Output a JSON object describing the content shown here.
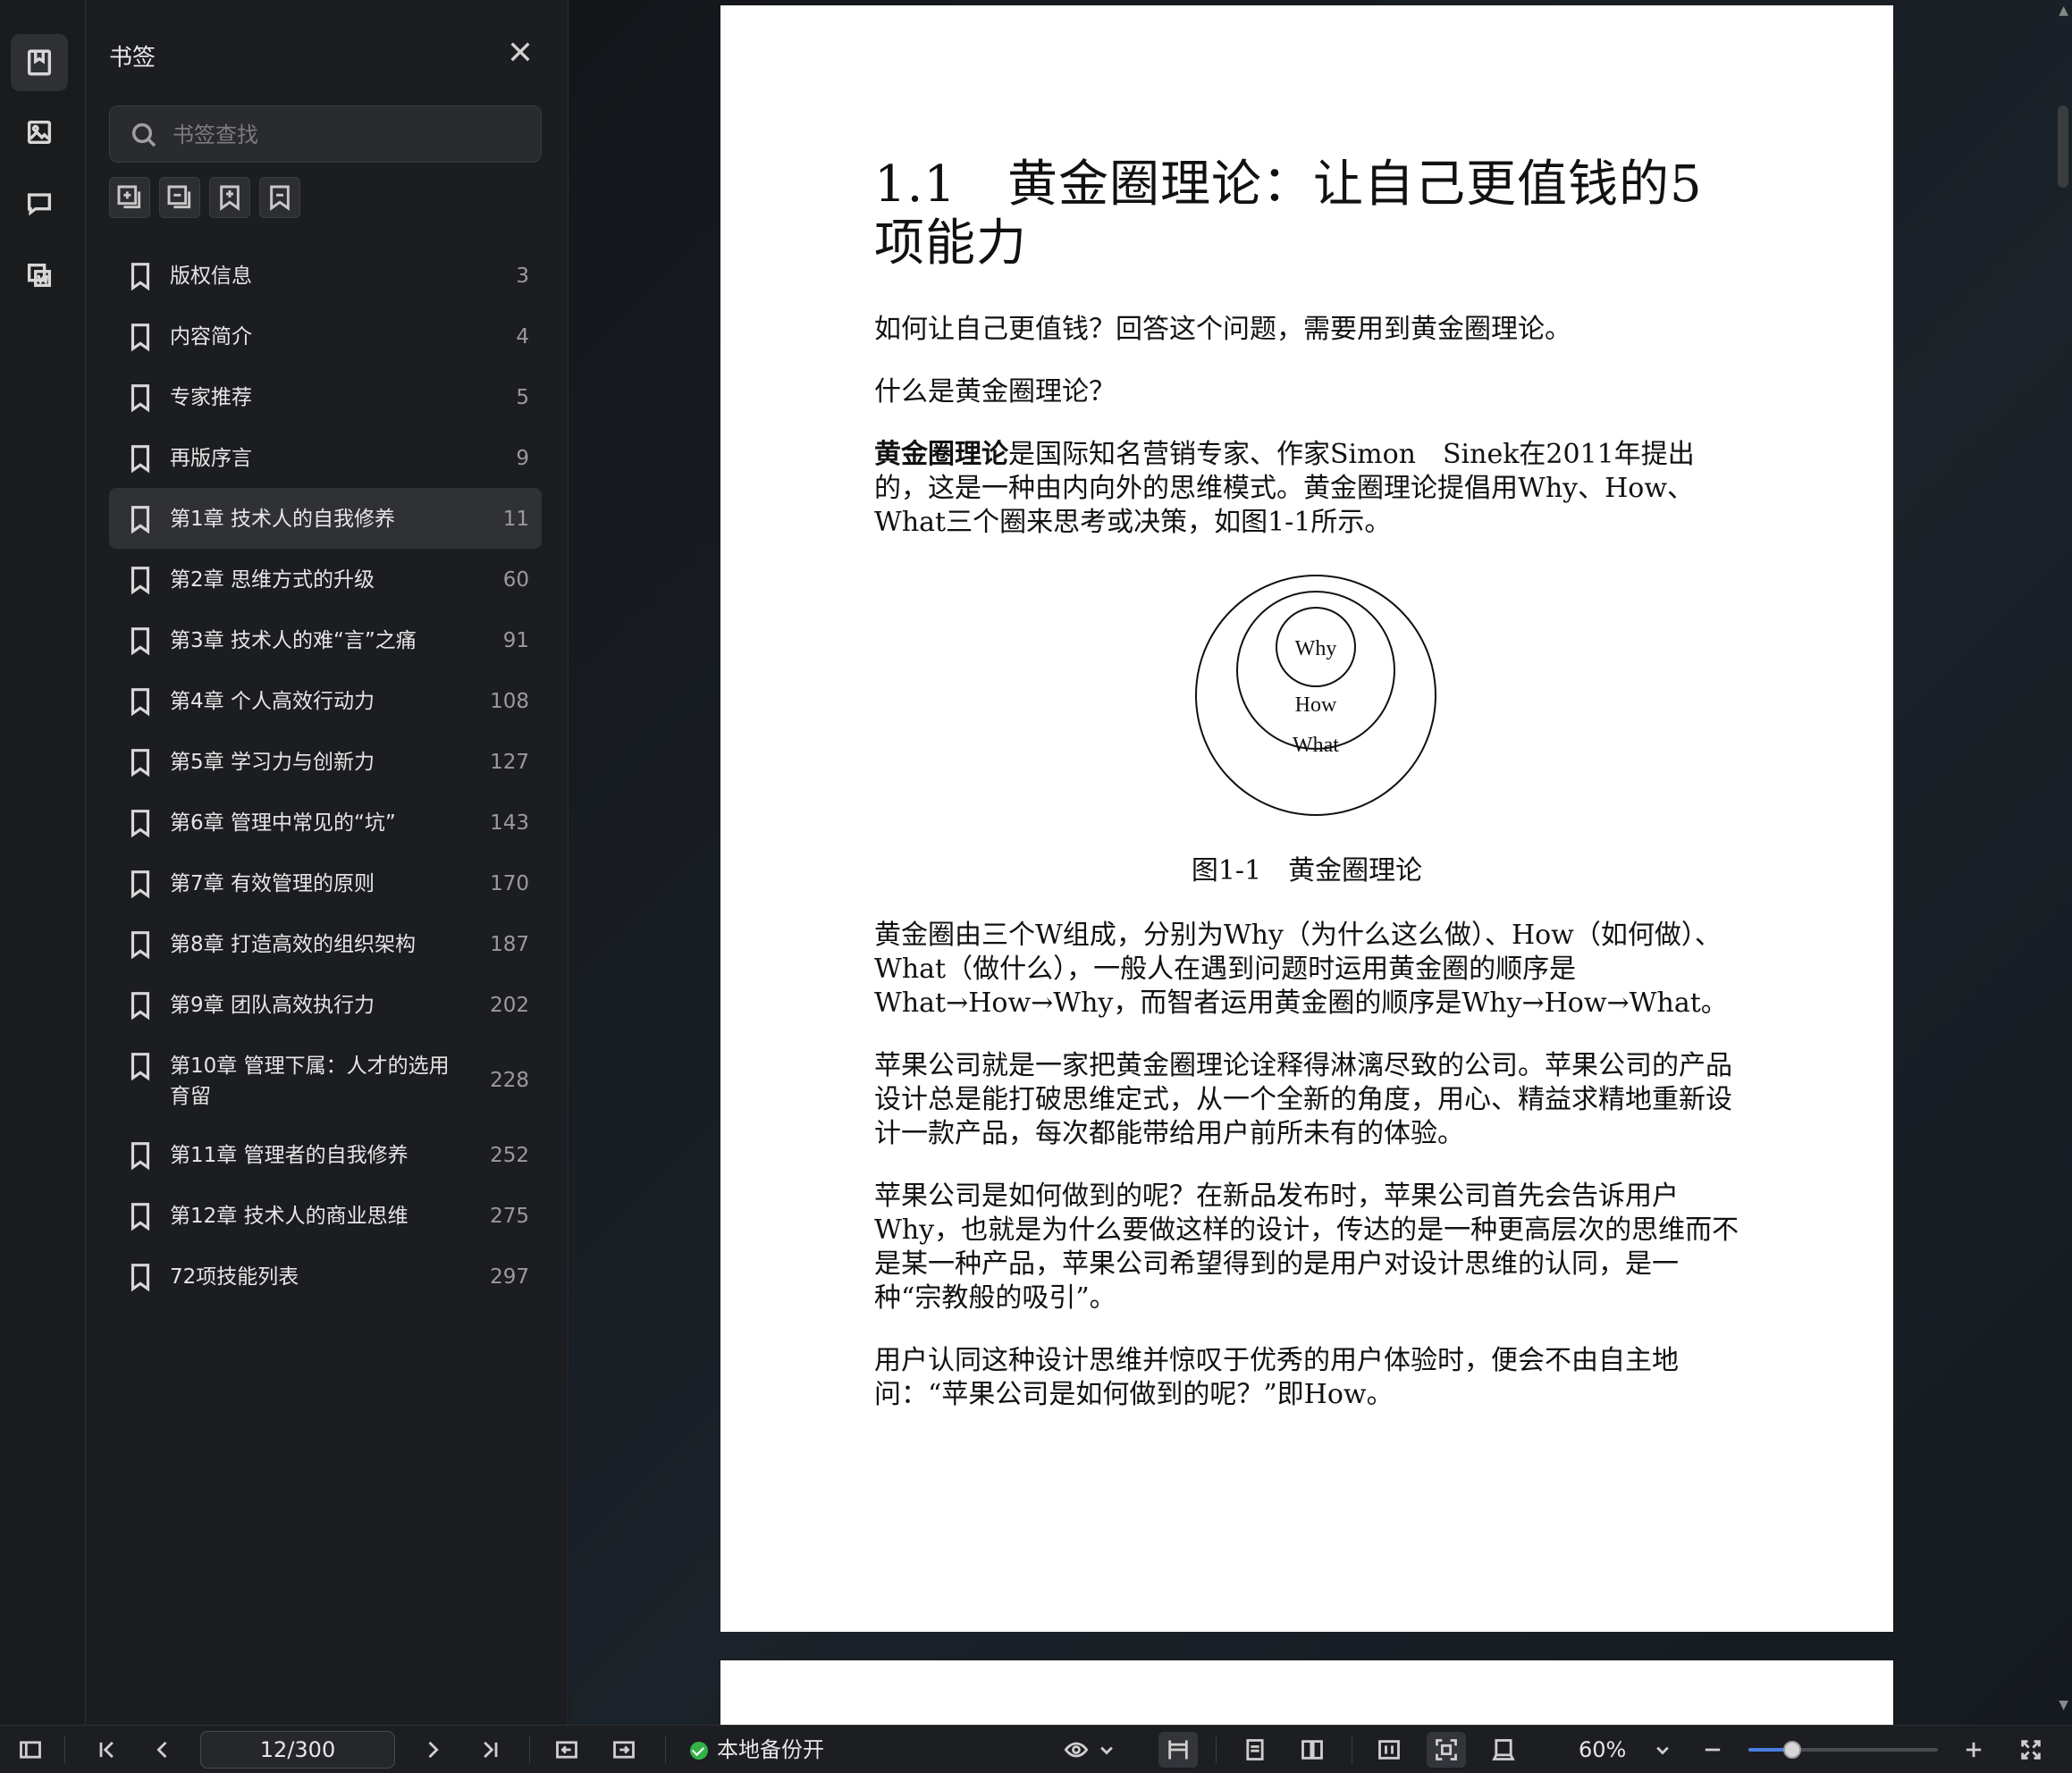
{
  "sidebar_panel": {
    "title": "书签",
    "search_placeholder": "书签查找",
    "tools": [
      "expand-all-icon",
      "collapse-all-icon",
      "add-bookmark-icon",
      "remove-bookmark-icon"
    ],
    "items": [
      {
        "label": "版权信息",
        "page": "3"
      },
      {
        "label": "内容简介",
        "page": "4"
      },
      {
        "label": "专家推荐",
        "page": "5"
      },
      {
        "label": "再版序言",
        "page": "9"
      },
      {
        "label": "第1章 技术人的自我修养",
        "page": "11"
      },
      {
        "label": "第2章 思维方式的升级",
        "page": "60"
      },
      {
        "label": "第3章 技术人的难“言”之痛",
        "page": "91"
      },
      {
        "label": "第4章 个人高效行动力",
        "page": "108"
      },
      {
        "label": "第5章 学习力与创新力",
        "page": "127"
      },
      {
        "label": "第6章 管理中常见的“坑”",
        "page": "143"
      },
      {
        "label": "第7章 有效管理的原则",
        "page": "170"
      },
      {
        "label": "第8章 打造高效的组织架构",
        "page": "187"
      },
      {
        "label": "第9章 团队高效执行力",
        "page": "202"
      },
      {
        "label": "第10章 管理下属：人才的选用育留",
        "page": "228"
      },
      {
        "label": "第11章 管理者的自我修养",
        "page": "252"
      },
      {
        "label": "第12章 技术人的商业思维",
        "page": "275"
      },
      {
        "label": "72项技能列表",
        "page": "297"
      }
    ],
    "active_index": 4
  },
  "document": {
    "heading": "1.1　黄金圈理论：让自己更值钱的5项能力",
    "p1": "如何让自己更值钱？回答这个问题，需要用到黄金圈理论。",
    "p2": "什么是黄金圈理论？",
    "p3_bold": "黄金圈理论",
    "p3_rest": "是国际知名营销专家、作家Simon　Sinek在2011年提出的，这是一种由内向外的思维模式。黄金圈理论提倡用Why、How、What三个圈来思考或决策，如图1-1所示。",
    "figure": {
      "inner": "Why",
      "middle": "How",
      "outer": "What"
    },
    "caption": "图1-1　黄金圈理论",
    "p4": "黄金圈由三个W组成，分别为Why（为什么这么做）、How（如何做）、What（做什么），一般人在遇到问题时运用黄金圈的顺序是What→How→Why，而智者运用黄金圈的顺序是Why→How→What。",
    "p5": "苹果公司就是一家把黄金圈理论诠释得淋漓尽致的公司。苹果公司的产品设计总是能打破思维定式，从一个全新的角度，用心、精益求精地重新设计一款产品，每次都能带给用户前所未有的体验。",
    "p6": "苹果公司是如何做到的呢？在新品发布时，苹果公司首先会告诉用户Why，也就是为什么要做这样的设计，传达的是一种更高层次的思维而不是某一种产品，苹果公司希望得到的是用户对设计思维的认同，是一种“宗教般的吸引”。",
    "p7": "用户认同这种设计思维并惊叹于优秀的用户体验时，便会不由自主地问：“苹果公司是如何做到的呢？”即How。"
  },
  "statusbar": {
    "page_value": "12/300",
    "backup_label": "本地备份开",
    "zoom": "60%",
    "zoom_fraction": 0.23
  },
  "colors": {
    "accent": "#4a7fe0",
    "backup_on": "#34b24a",
    "panel_bg": "#1c1d20",
    "page_bg": "#ffffff"
  }
}
